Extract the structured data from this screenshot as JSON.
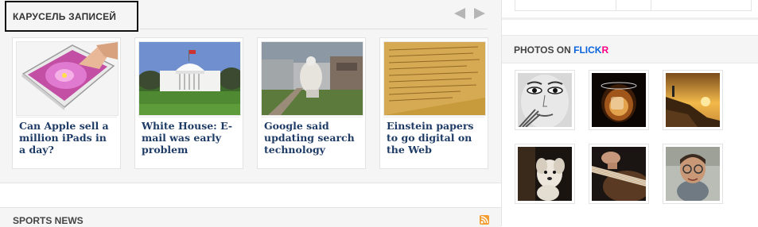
{
  "carousel": {
    "title": "КАРУСЕЛЬ ЗАПИСЕЙ",
    "prev_label": "Previous",
    "next_label": "Next",
    "items": [
      {
        "title": "Can Apple sell a million iPads in a day?",
        "image": "ipad-photo"
      },
      {
        "title": "White House: E-mail was early problem",
        "image": "white-house-photo"
      },
      {
        "title": "Google said updating search technology",
        "image": "statue-photo"
      },
      {
        "title": "Einstein papers to go digital on the Web",
        "image": "handwritten-papers-photo"
      }
    ]
  },
  "sports": {
    "title": "SPORTS NEWS",
    "icon": "rss-icon"
  },
  "flickr": {
    "title_prefix": "PHOTOS ON ",
    "title_brand_a": "FLICK",
    "title_brand_b": "R",
    "photos": [
      "sketch-face-photo",
      "whisky-glass-photo",
      "sunset-coast-photo",
      "dog-photo",
      "guitar-photo",
      "child-photo"
    ]
  },
  "colors": {
    "link": "#1e3b66",
    "flickr_blue": "#0a63dc",
    "flickr_pink": "#ff0084",
    "rss": "#f39d32"
  }
}
